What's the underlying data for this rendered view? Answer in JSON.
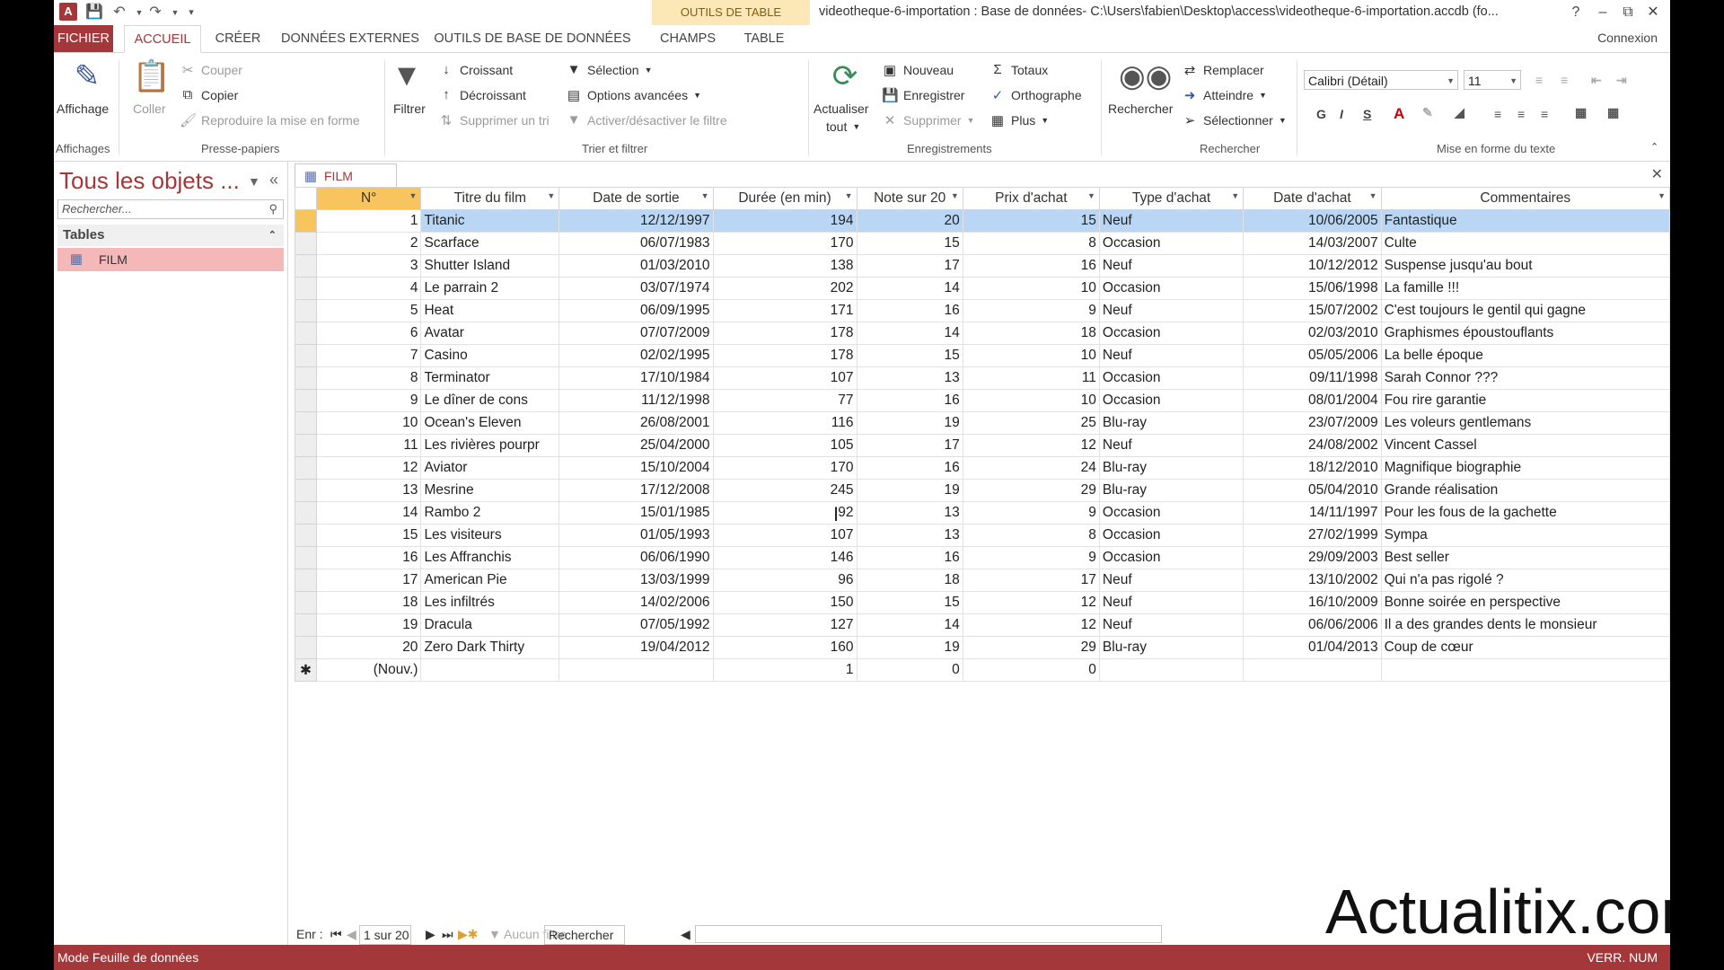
{
  "app": {
    "logo": "A",
    "context_tab": "OUTILS DE TABLE",
    "window_title": "videotheque-6-importation : Base de données- C:\\Users\\fabien\\Desktop\\access\\videotheque-6-importation.accdb (fo...",
    "help": "?",
    "connexion": "Connexion"
  },
  "tabs": [
    {
      "label": "FICHIER"
    },
    {
      "label": "ACCUEIL"
    },
    {
      "label": "CRÉER"
    },
    {
      "label": "DONNÉES EXTERNES"
    },
    {
      "label": "OUTILS DE BASE DE DONNÉES"
    },
    {
      "label": "CHAMPS"
    },
    {
      "label": "TABLE"
    }
  ],
  "ribbon": {
    "affichage": "Affichage",
    "coller": "Coller",
    "couper": "Couper",
    "copier": "Copier",
    "reproduire": "Reproduire la mise en forme",
    "filtrer": "Filtrer",
    "croissant": "Croissant",
    "decroissant": "Décroissant",
    "supprimer_tri": "Supprimer un tri",
    "selection": "Sélection",
    "options_avancees": "Options avancées",
    "activer_filtre": "Activer/désactiver le filtre",
    "actualiser": "Actualiser",
    "tout": "tout",
    "nouveau": "Nouveau",
    "enregistrer": "Enregistrer",
    "supprimer": "Supprimer",
    "totaux": "Totaux",
    "orthographe": "Orthographe",
    "plus": "Plus",
    "rechercher": "Rechercher",
    "remplacer": "Remplacer",
    "atteindre": "Atteindre",
    "selectionner": "Sélectionner",
    "font_name": "Calibri (Détail)",
    "font_size": "11",
    "bold": "G",
    "italic": "I",
    "underline": "S",
    "groups": {
      "affichages": "Affichages",
      "presse_papiers": "Presse-papiers",
      "trier_filtrer": "Trier et filtrer",
      "enregistrements": "Enregistrements",
      "rechercher": "Rechercher",
      "mise_en_forme": "Mise en forme du texte"
    }
  },
  "nav": {
    "title": "Tous les objets ...",
    "search_placeholder": "Rechercher...",
    "section": "Tables",
    "item": "FILM"
  },
  "document": {
    "tab_label": "FILM",
    "columns": [
      "N°",
      "Titre du film",
      "Date de sortie",
      "Durée (en min)",
      "Note sur 20",
      "Prix d'achat",
      "Type d'achat",
      "Date d'achat",
      "Commentaires"
    ],
    "rows": [
      [
        "1",
        "Titanic",
        "12/12/1997",
        "194",
        "20",
        "15",
        "Neuf",
        "10/06/2005",
        "Fantastique"
      ],
      [
        "2",
        "Scarface",
        "06/07/1983",
        "170",
        "15",
        "8",
        "Occasion",
        "14/03/2007",
        "Culte"
      ],
      [
        "3",
        "Shutter Island",
        "01/03/2010",
        "138",
        "17",
        "16",
        "Neuf",
        "10/12/2012",
        "Suspense jusqu'au bout"
      ],
      [
        "4",
        "Le parrain 2",
        "03/07/1974",
        "202",
        "14",
        "10",
        "Occasion",
        "15/06/1998",
        "La famille !!!"
      ],
      [
        "5",
        "Heat",
        "06/09/1995",
        "171",
        "16",
        "9",
        "Neuf",
        "15/07/2002",
        "C'est toujours le gentil qui gagne"
      ],
      [
        "6",
        "Avatar",
        "07/07/2009",
        "178",
        "14",
        "18",
        "Occasion",
        "02/03/2010",
        "Graphismes époustouflants"
      ],
      [
        "7",
        "Casino",
        "02/02/1995",
        "178",
        "15",
        "10",
        "Neuf",
        "05/05/2006",
        "La belle époque"
      ],
      [
        "8",
        "Terminator",
        "17/10/1984",
        "107",
        "13",
        "11",
        "Occasion",
        "09/11/1998",
        "Sarah Connor ???"
      ],
      [
        "9",
        "Le dîner de cons",
        "11/12/1998",
        "77",
        "16",
        "10",
        "Occasion",
        "08/01/2004",
        "Fou rire garantie"
      ],
      [
        "10",
        "Ocean's Eleven",
        "26/08/2001",
        "116",
        "19",
        "25",
        "Blu-ray",
        "23/07/2009",
        "Les voleurs gentlemans"
      ],
      [
        "11",
        "Les rivières pourpr",
        "25/04/2000",
        "105",
        "17",
        "12",
        "Neuf",
        "24/08/2002",
        "Vincent Cassel"
      ],
      [
        "12",
        "Aviator",
        "15/10/2004",
        "170",
        "16",
        "24",
        "Blu-ray",
        "18/12/2010",
        "Magnifique biographie"
      ],
      [
        "13",
        "Mesrine",
        "17/12/2008",
        "245",
        "19",
        "29",
        "Blu-ray",
        "05/04/2010",
        "Grande réalisation"
      ],
      [
        "14",
        "Rambo 2",
        "15/01/1985",
        "92",
        "13",
        "9",
        "Occasion",
        "14/11/1997",
        "Pour les fous de la gachette"
      ],
      [
        "15",
        "Les visiteurs",
        "01/05/1993",
        "107",
        "13",
        "8",
        "Occasion",
        "27/02/1999",
        "Sympa"
      ],
      [
        "16",
        "Les Affranchis",
        "06/06/1990",
        "146",
        "16",
        "9",
        "Occasion",
        "29/09/2003",
        "Best seller"
      ],
      [
        "17",
        "American Pie",
        "13/03/1999",
        "96",
        "18",
        "17",
        "Neuf",
        "13/10/2002",
        "Qui n'a pas rigolé ?"
      ],
      [
        "18",
        "Les infiltrés",
        "14/02/2006",
        "150",
        "15",
        "12",
        "Neuf",
        "16/10/2009",
        "Bonne soirée en perspective"
      ],
      [
        "19",
        "Dracula",
        "07/05/1992",
        "127",
        "14",
        "12",
        "Neuf",
        "06/06/2006",
        "Il a des grandes dents le monsieur"
      ],
      [
        "20",
        "Zero Dark Thirty",
        "19/04/2012",
        "160",
        "19",
        "29",
        "Blu-ray",
        "01/04/2013",
        "Coup de cœur"
      ]
    ],
    "new_row": {
      "marker": "✱",
      "id": "(Nouv.)",
      "duree": "1",
      "note": "0",
      "prix": "0"
    }
  },
  "record_nav": {
    "label": "Enr :",
    "count": "1 sur 20",
    "filter": "Aucun filtre",
    "search": "Rechercher"
  },
  "status": {
    "left": "Mode Feuille de données",
    "right": "VERR. NUM"
  },
  "watermark": "Actualitix.com",
  "colors": {
    "accent": "#a4373a",
    "selection": "#b9d7f5",
    "current_cell": "#f8c45e",
    "context_tab": "#fbe8b6"
  }
}
